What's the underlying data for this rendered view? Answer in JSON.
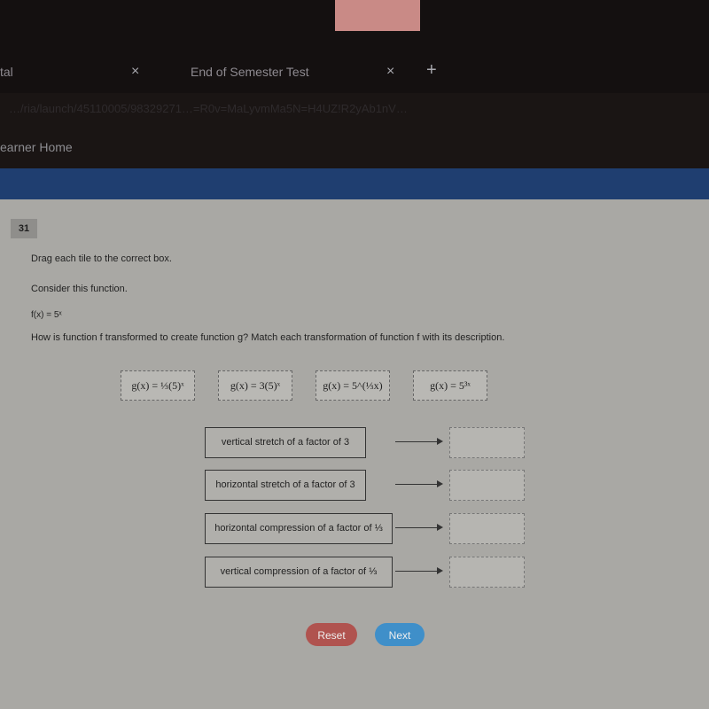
{
  "browser": {
    "tabs": [
      {
        "label": "tal"
      },
      {
        "label": "End of Semester Test"
      }
    ],
    "close_glyph": "×",
    "new_tab_glyph": "+",
    "url": "…/ria/launch/45110005/98329271…=R0v=MaLyvmMa5N=H4UZ!R2yAb1nV…",
    "nav_link": "earner Home"
  },
  "question": {
    "number": "31",
    "instruction": "Drag each tile to the correct box.",
    "consider": "Consider this function.",
    "function": "f(x) = 5ˣ",
    "prompt": "How is function f transformed to create function g? Match each transformation of function f with its description.",
    "tiles": [
      {
        "label": "g(x) = ⅓(5)ˣ"
      },
      {
        "label": "g(x) = 3(5)ˣ"
      },
      {
        "label": "g(x) = 5^(⅓x)"
      },
      {
        "label": "g(x) = 5³ˣ"
      }
    ],
    "descriptions": [
      {
        "label": "vertical stretch of a factor of 3"
      },
      {
        "label": "horizontal stretch of a factor of 3"
      },
      {
        "label": "horizontal compression of a factor of ⅓"
      },
      {
        "label": "vertical compression of a factor of ⅓"
      }
    ]
  },
  "buttons": {
    "reset": "Reset",
    "next": "Next"
  },
  "colors": {
    "reset": "#b0534f",
    "next": "#3f8fc9",
    "header": "#1f3e70"
  }
}
